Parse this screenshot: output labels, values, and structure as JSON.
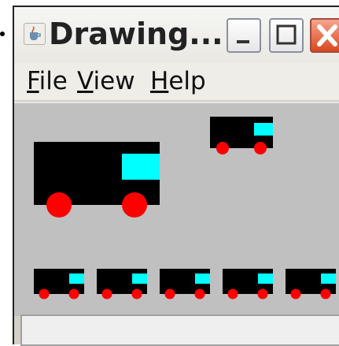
{
  "window": {
    "title": "Drawing...",
    "title_icon": "java-cup-icon",
    "buttons": [
      "minimize-icon",
      "maximize-icon",
      "close-icon"
    ]
  },
  "menu": {
    "file": {
      "mnemonic": "F",
      "rest": "ile"
    },
    "view": {
      "mnemonic": "V",
      "rest": "iew"
    },
    "help": {
      "mnemonic": "H",
      "rest": "elp"
    }
  },
  "canvas": {
    "background": "#c0c0c0",
    "truck_colors": {
      "body": "#000000",
      "cab": "#00ffff",
      "wheels": "#ff0000"
    }
  },
  "status": {
    "text": ""
  }
}
